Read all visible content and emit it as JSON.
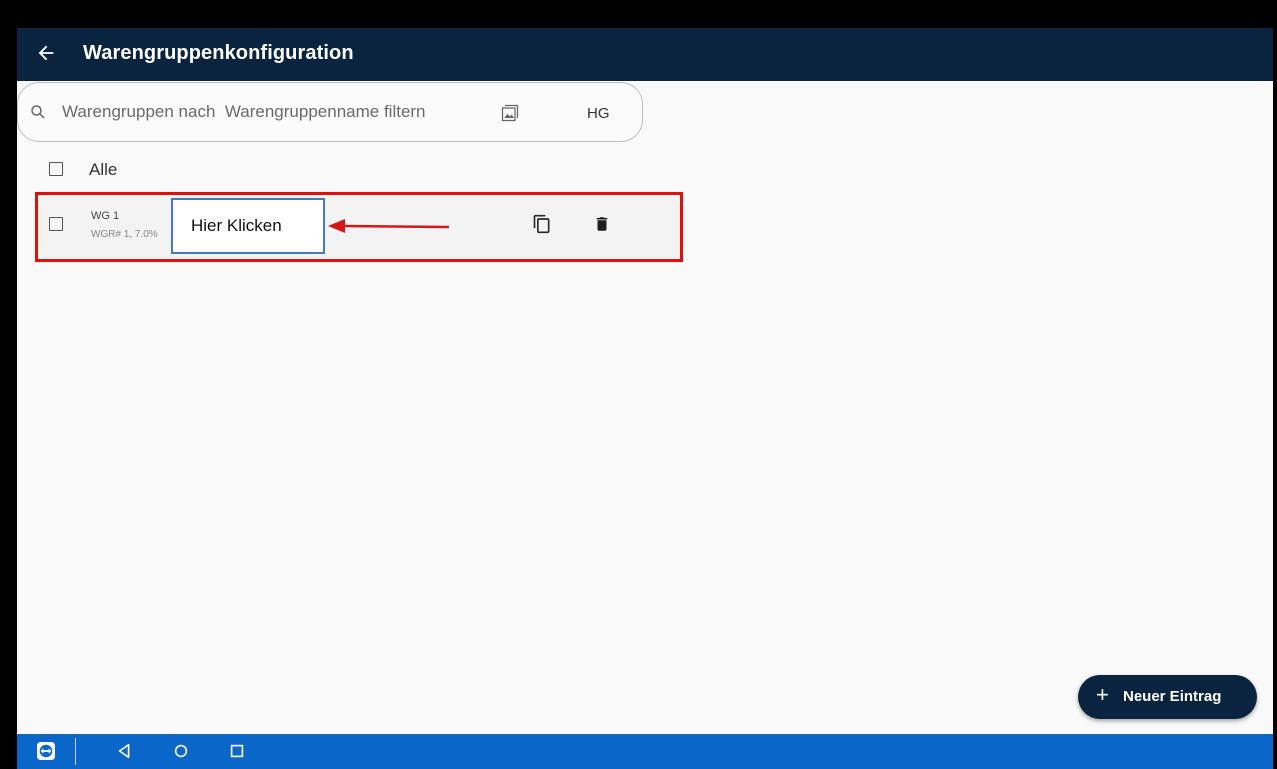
{
  "header": {
    "back_icon": "arrow-left-icon",
    "title": "Warengruppenkonfiguration"
  },
  "search": {
    "icon": "search-icon",
    "placeholder": "Warengruppen nach  Warengruppenname filtern",
    "value": "",
    "image_icon": "image-icon",
    "hg_label": "HG"
  },
  "select_all": {
    "label": "Alle",
    "checked": false
  },
  "items": [
    {
      "name": "WG 1",
      "details": "WGR# 1, 7.0%",
      "checked": false,
      "copy_icon": "copy-icon",
      "delete_icon": "trash-icon"
    }
  ],
  "annotation": {
    "callout_text": "Hier Klicken",
    "highlight_color": "#e01010",
    "callout_border_color": "#4a78c8"
  },
  "fab": {
    "icon": "plus-icon",
    "label": "Neuer Eintrag"
  },
  "system_nav": {
    "teamviewer_icon": "teamviewer-icon",
    "back_icon": "nav-back-icon",
    "home_icon": "nav-home-icon",
    "recents_icon": "nav-recents-icon",
    "color": "#0a66c8"
  },
  "colors": {
    "appbar": "#0a2440",
    "background": "#f9f9f9"
  }
}
